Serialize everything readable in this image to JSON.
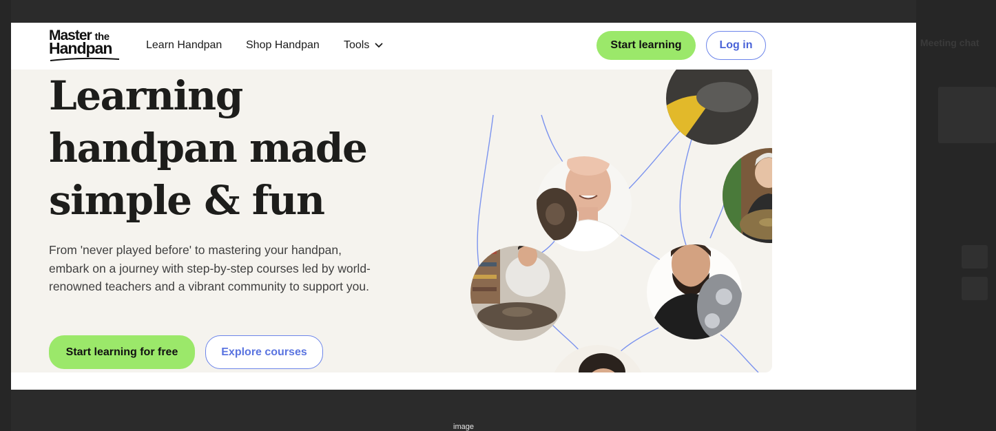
{
  "caption": "image",
  "backdrop": {
    "side_title": "Meeting chat"
  },
  "nav": {
    "logo_line1": "Master",
    "logo_line1_small": "the",
    "logo_line2": "Handpan",
    "links": [
      "Learn Handpan",
      "Shop Handpan",
      "Tools"
    ],
    "tools_icon": "chevron-down-icon",
    "cta_primary": "Start learning",
    "cta_secondary": "Log in"
  },
  "hero": {
    "headline": [
      "Learning",
      "handpan made",
      "simple & fun"
    ],
    "description": "From 'never played before' to mastering your handpan, embark on a journey with step-by-step courses led by world-renowned teachers and a vibrant community to support you.",
    "cta_primary": "Start learning for free",
    "cta_secondary": "Explore courses"
  },
  "colors": {
    "accent_green": "#9be86a",
    "accent_blue": "#4a63d8",
    "hero_bg": "#f5f3ee",
    "line_blue": "#7b93ee"
  }
}
